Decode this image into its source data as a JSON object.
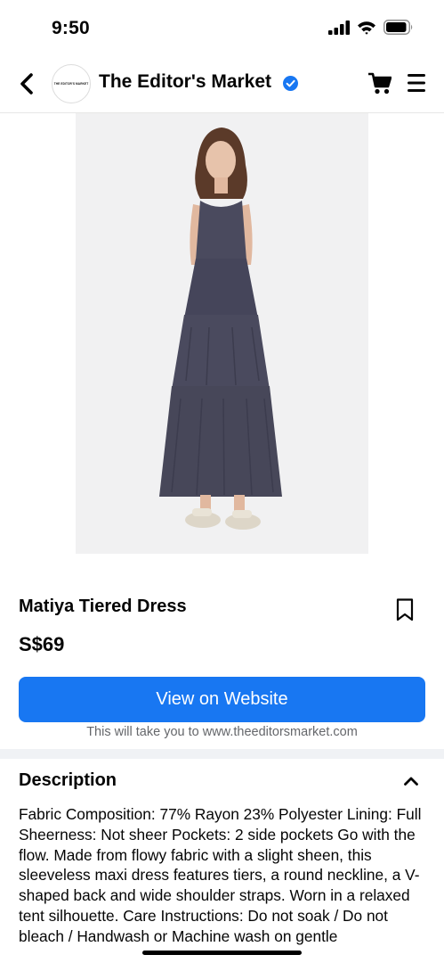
{
  "status_bar": {
    "time": "9:50"
  },
  "header": {
    "avatar_text": "THE EDITOR'S MARKET",
    "shop_name": "The Editor's Market",
    "icons": [
      "chevron-left-icon",
      "verified-badge-icon",
      "cart-icon",
      "hamburger-menu-icon"
    ]
  },
  "product": {
    "image_alt": "Matiya Tiered Dress",
    "title": "Matiya Tiered Dress",
    "price": "S$69",
    "cta_label": "View on Website",
    "cta_note": "This will take you to www.theeditorsmarket.com"
  },
  "description": {
    "heading": "Description",
    "text": "Fabric Composition: 77% Rayon 23% Polyester Lining: Full Sheerness: Not sheer Pockets: 2 side pockets Go with the flow. Made from flowy fabric with a slight sheen, this sleeveless maxi dress features tiers, a round neckline, a V-shaped back and wide shoulder straps. Worn in a relaxed tent silhouette. Care Instructions: Do not soak / Do not bleach / Handwash or Machine wash on gentle"
  },
  "colors": {
    "accent": "#1877f2",
    "dress": "#4a4a5e",
    "secondary_text": "#65676b",
    "divider": "#f0f2f5"
  }
}
